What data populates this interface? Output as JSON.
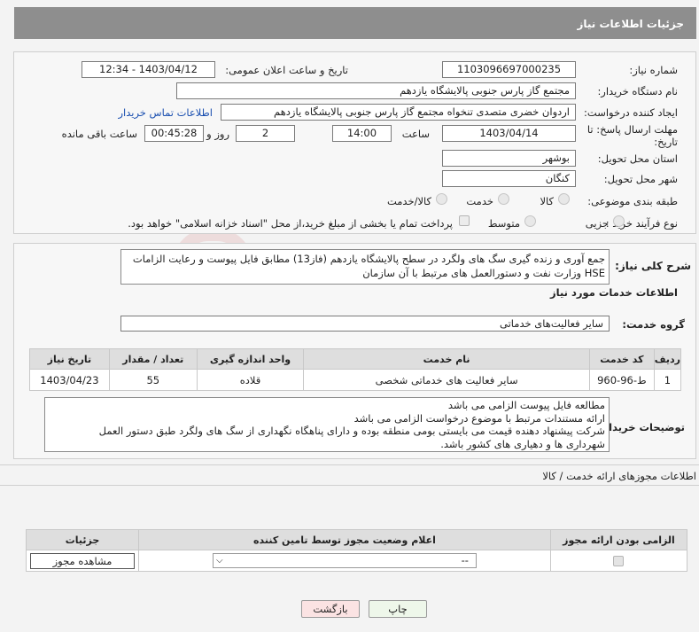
{
  "header": {
    "title": "جزئیات اطلاعات نیاز"
  },
  "info": {
    "need_number_label": "شماره نیاز:",
    "need_number": "1103096697000235",
    "announce_label": "تاریخ و ساعت اعلان عمومی:",
    "announce_value": "1403/04/12 - 12:34",
    "buyer_label": "نام دستگاه خریدار:",
    "buyer_value": "مجتمع گاز پارس جنوبی  پالایشگاه یازدهم",
    "creator_label": "ایجاد کننده درخواست:",
    "creator_value": "اردوان خضری متصدی تنخواه مجتمع گاز پارس جنوبی  پالایشگاه یازدهم",
    "contact_link": "اطلاعات تماس خریدار",
    "deadline_label_1": "مهلت ارسال پاسخ: تا",
    "deadline_label_2": "تاریخ:",
    "deadline_date": "1403/04/14",
    "time_label": "ساعت",
    "deadline_time": "14:00",
    "days_value": "2",
    "days_label": "روز و",
    "remaining_time": "00:45:28",
    "remaining_label": "ساعت باقی مانده",
    "province_label": "استان محل تحویل:",
    "province_value": "بوشهر",
    "city_label": "شهر محل تحویل:",
    "city_value": "کنگان",
    "category_label": "طبقه بندی موضوعی:",
    "category_options": [
      "کالا",
      "خدمت",
      "کالا/خدمت"
    ],
    "process_label": "نوع فرآیند خرید :",
    "process_options": [
      "جزیی",
      "متوسط"
    ],
    "payment_note": "پرداخت تمام یا بخشی از مبلغ خرید،از محل \"اسناد خزانه اسلامی\" خواهد بود."
  },
  "details": {
    "summary_label": "شرح کلی نیاز:",
    "summary_text": "جمع آوری و زنده گیری سگ های ولگرد در سطح پالایشگاه یازدهم (فاز13) مطابق فایل پیوست و رعایت الزامات HSE وزارت نفت و دستورالعمل های مرتبط با آن سازمان",
    "services_title": "اطلاعات خدمات مورد نیاز",
    "group_label": "گروه خدمت:",
    "group_value": "سایر فعالیت‌های خدماتی",
    "table_headers": [
      "ردیف",
      "کد خدمت",
      "نام خدمت",
      "واحد اندازه گیری",
      "تعداد / مقدار",
      "تاریخ نیاز"
    ],
    "table_rows": [
      {
        "row": "1",
        "code": "ط-96-960",
        "name": "سایر فعالیت های خدماتی شخصی",
        "unit": "قلاده",
        "qty": "55",
        "date": "1403/04/23"
      }
    ],
    "notes_label": "توضیحات خریدار:",
    "notes_lines": [
      "مطالعه فایل پیوست الزامی می باشد",
      "ارائه مستندات مرتبط با موضوع درخواست الزامی می باشد",
      "شرکت پیشنهاد دهنده قیمت می بایستی بومی منطقه بوده و دارای پناهگاه نگهداری از سگ های ولگرد طبق دستور العمل",
      "شهرداری ها و دهیاری های کشور باشد."
    ]
  },
  "permits": {
    "title": "اطلاعات مجوزهای ارائه خدمت / کالا",
    "headers": [
      "الزامی بودن ارائه مجوز",
      "اعلام وضعیت مجوز توسط تامین کننده",
      "جزئیات"
    ],
    "select_value": "--",
    "view_button": "مشاهده مجوز"
  },
  "footer": {
    "print_label": "چاپ",
    "back_label": "بازگشت"
  }
}
